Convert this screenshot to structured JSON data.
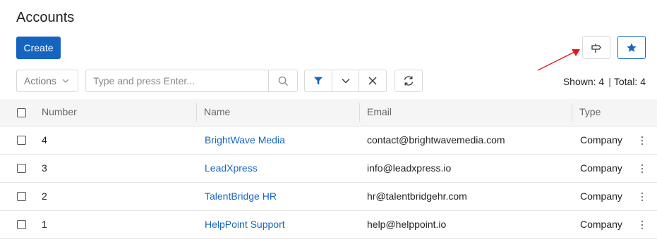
{
  "page": {
    "title": "Accounts"
  },
  "toolbar": {
    "create_label": "Create",
    "actions_label": "Actions",
    "search_placeholder": "Type and press Enter...",
    "search_value": ""
  },
  "counts": {
    "shown_label": "Shown: 4",
    "total_label": "Total: 4",
    "separator": "|"
  },
  "table": {
    "columns": [
      "Number",
      "Name",
      "Email",
      "Type"
    ],
    "rows": [
      {
        "number": "4",
        "name": "BrightWave Media",
        "email": "contact@brightwavemedia.com",
        "type": "Company"
      },
      {
        "number": "3",
        "name": "LeadXpress",
        "email": "info@leadxpress.io",
        "type": "Company"
      },
      {
        "number": "2",
        "name": "TalentBridge HR",
        "email": "hr@talentbridgehr.com",
        "type": "Company"
      },
      {
        "number": "1",
        "name": "HelpPoint Support",
        "email": "help@helppoint.io",
        "type": "Company"
      }
    ]
  },
  "colors": {
    "accent": "#1565c0",
    "annotation_arrow": "#e8141b"
  },
  "icons": [
    "signpost-icon",
    "star-icon",
    "chevron-down-icon",
    "search-icon",
    "filter-icon",
    "close-icon",
    "refresh-icon",
    "kebab-icon"
  ]
}
